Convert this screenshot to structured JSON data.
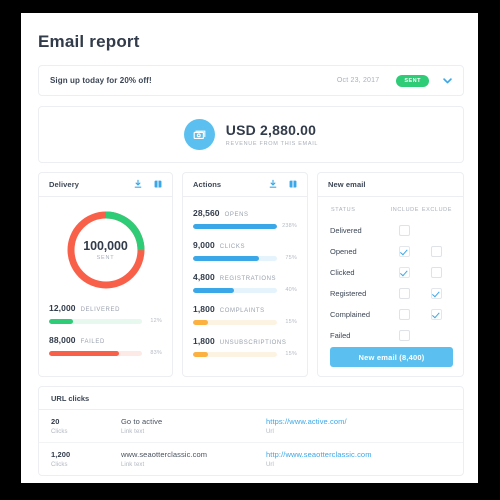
{
  "page": {
    "title": "Email report"
  },
  "campaign": {
    "subject": "Sign up today for 20% off!",
    "date": "Oct 23, 2017",
    "status": "SENT",
    "expand_icon": "chevron-down-icon"
  },
  "revenue": {
    "icon": "money-icon",
    "amount": "USD 2,880.00",
    "label": "REVENUE FROM THIS EMAIL"
  },
  "delivery": {
    "title": "Delivery",
    "download_icon": "download-icon",
    "report_icon": "book-icon",
    "donut": {
      "value": "100,000",
      "label": "SENT",
      "segments": [
        {
          "name": "delivered",
          "percent": 12,
          "color": "#2ecc77"
        },
        {
          "name": "failed",
          "percent": 88,
          "color": "#f8604a"
        }
      ]
    },
    "metrics": [
      {
        "value": "12,000",
        "name": "DELIVERED",
        "percent_label": "12%",
        "fill": 26,
        "color": "#2ecc77",
        "track": "#e7f8ee"
      },
      {
        "value": "88,000",
        "name": "FAILED",
        "percent_label": "83%",
        "fill": 75,
        "color": "#f8604a",
        "track": "#fdeae7"
      }
    ]
  },
  "actions": {
    "title": "Actions",
    "download_icon": "download-icon",
    "report_icon": "book-icon",
    "metrics": [
      {
        "value": "28,560",
        "name": "OPENS",
        "percent_label": "238%",
        "fill": 100,
        "color": "#3aa7e8",
        "track": "#e4f3fc"
      },
      {
        "value": "9,000",
        "name": "CLICKS",
        "percent_label": "75%",
        "fill": 79,
        "color": "#3aa7e8",
        "track": "#e4f3fc"
      },
      {
        "value": "4,800",
        "name": "REGISTRATIONS",
        "percent_label": "40%",
        "fill": 49,
        "color": "#3aa7e8",
        "track": "#e4f3fc"
      },
      {
        "value": "1,800",
        "name": "COMPLAINTS",
        "percent_label": "15%",
        "fill": 18,
        "color": "#fbb040",
        "track": "#fdf3e3"
      },
      {
        "value": "1,800",
        "name": "UNSUBSCRIPTIONS",
        "percent_label": "15%",
        "fill": 18,
        "color": "#fbb040",
        "track": "#fdf3e3"
      }
    ]
  },
  "new_email": {
    "title": "New email",
    "columns": {
      "status": "STATUS",
      "include": "INCLUDE",
      "exclude": "EXCLUDE"
    },
    "rows": [
      {
        "label": "Delivered",
        "include": false,
        "exclude": null
      },
      {
        "label": "Opened",
        "include": true,
        "exclude": false
      },
      {
        "label": "Clicked",
        "include": true,
        "exclude": false
      },
      {
        "label": "Registered",
        "include": false,
        "exclude": true
      },
      {
        "label": "Complained",
        "include": false,
        "exclude": true
      },
      {
        "label": "Failed",
        "include": false,
        "exclude": null
      }
    ],
    "button_label": "New email (8,400)"
  },
  "url_clicks": {
    "title": "URL clicks",
    "labels": {
      "clicks": "Clicks",
      "link_text": "Link text",
      "url": "Url"
    },
    "rows": [
      {
        "clicks": "20",
        "link_text": "Go to active",
        "url": "https://www.active.com/"
      },
      {
        "clicks": "1,200",
        "link_text": "www.seaotterclassic.com",
        "url": "http://www.seaotterclassic.com"
      }
    ]
  },
  "colors": {
    "accent_blue": "#3aa7e8",
    "button_blue": "#5bc0ef",
    "green": "#2ecc77",
    "red": "#f8604a",
    "orange": "#fbb040",
    "text_dark": "#313b4a",
    "text_muted": "#a9b0bb"
  }
}
